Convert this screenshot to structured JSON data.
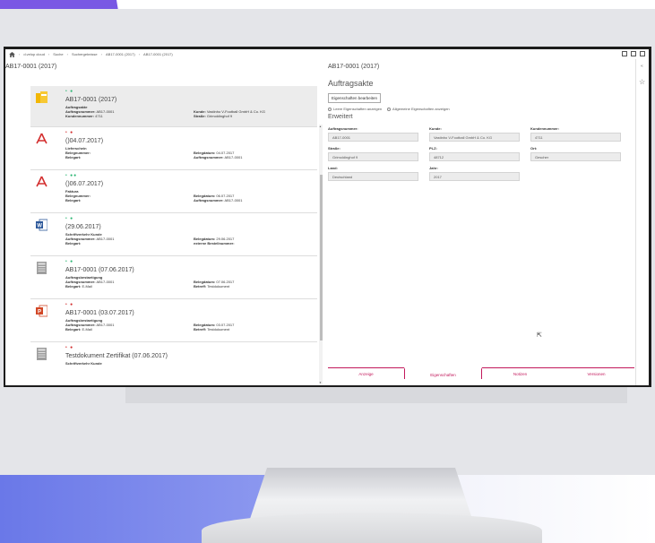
{
  "breadcrumb": {
    "items": [
      "d.velop cloud",
      "Suche",
      "Suchergebnisse",
      "AB17-0001 (2017)",
      "AB17-0001 (2017)"
    ]
  },
  "left_title": "AB17-0001 (2017)",
  "right_title": "AB17-0001 (2017)",
  "documents": [
    {
      "icon": "folder-icon",
      "dots": "• ●",
      "title": "AB17-0001 (2017)",
      "type": "Auftragsakte",
      "l1_label": "Auftragsnummer:",
      "l1_value": "AB17-0001",
      "l2_label": "Kundennummer:",
      "l2_value": "4711",
      "r1_label": "Kunde:",
      "r1_value": "Vastinho V-Football GmbH & Co. KG",
      "r2_label": "Straße:",
      "r2_value": "Grimoldinghof 9"
    },
    {
      "icon": "pdf-icon",
      "dots": "• ●",
      "title": "()04.07.2017)",
      "type": "Lieferschein",
      "l1_label": "Belegnummer:",
      "l1_value": "",
      "l2_label": "Belegart:",
      "l2_value": "",
      "r1_label": "Belegdatum:",
      "r1_value": "04.07.2017",
      "r2_label": "Auftragsnummer:",
      "r2_value": "AB17-0001"
    },
    {
      "icon": "pdf-icon",
      "dots": "• ●●",
      "title": "()06.07.2017)",
      "type": "Faktura",
      "l1_label": "Belegnummer:",
      "l1_value": "",
      "l2_label": "Belegart:",
      "l2_value": "",
      "r1_label": "Belegdatum:",
      "r1_value": "06.07.2017",
      "r2_label": "Auftragsnummer:",
      "r2_value": "AB17-0001"
    },
    {
      "icon": "word-icon",
      "dots": "• ●",
      "title": "(29.06.2017)",
      "type": "Schriftverkehr Kunde",
      "l1_label": "Auftragsnummer:",
      "l1_value": "AB17-0001",
      "l2_label": "Belegart:",
      "l2_value": "",
      "r1_label": "Belegdatum:",
      "r1_value": "29.06.2017",
      "r2_label": "externe Bestellnummer:",
      "r2_value": ""
    },
    {
      "icon": "email-icon",
      "dots": "• ●",
      "title": "AB17-0001 (07.06.2017)",
      "type": "Auftragsbestaetigung",
      "l1_label": "Auftragsnummer:",
      "l1_value": "AB17-0001",
      "l2_label": "Belegart:",
      "l2_value": "E-Mail",
      "r1_label": "Belegdatum:",
      "r1_value": "07.06.2017",
      "r2_label": "Betreff:",
      "r2_value": "Testdokument"
    },
    {
      "icon": "powerpoint-icon",
      "dots": "• ●",
      "title": "AB17-0001 (03.07.2017)",
      "type": "Auftragsbestaetigung",
      "l1_label": "Auftragsnummer:",
      "l1_value": "AB17-0001",
      "l2_label": "Belegart:",
      "l2_value": "E-Mail",
      "r1_label": "Belegdatum:",
      "r1_value": "03.07.2017",
      "r2_label": "Betreff:",
      "r2_value": "Testdokument"
    },
    {
      "icon": "email-icon",
      "dots": "• ●",
      "title": "Testdokument Zertifikat (07.06.2017)",
      "type": "Schriftverkehr Kunde",
      "l1_label": "",
      "l1_value": "",
      "l2_label": "",
      "l2_value": "",
      "r1_label": "",
      "r1_value": "",
      "r2_label": "",
      "r2_value": ""
    }
  ],
  "panel": {
    "heading": "Auftragsakte",
    "edit_button": "Eigenschaften bearbeiten",
    "radio_empty": "Leere Eigenschaften anzeigen",
    "radio_general": "Allgemeine Eigenschaften anzeigen",
    "subheading": "Erweitert",
    "fields": [
      {
        "label": "Auftragsnummer:",
        "value": "AB17-0001"
      },
      {
        "label": "Kunde:",
        "value": "Vastinho V-Football GmbH & Co. KG"
      },
      {
        "label": "Kundennummer:",
        "value": "4711"
      },
      {
        "label": "Straße:",
        "value": "Grimoldinghof 9"
      },
      {
        "label": "PLZ:",
        "value": "48712"
      },
      {
        "label": "Ort:",
        "value": "Gescher"
      },
      {
        "label": "Land:",
        "value": "Deutschland"
      },
      {
        "label": "Jahr:",
        "value": "2017"
      }
    ],
    "tabs": [
      "Anzeige",
      "Eigenschaften",
      "Notizen",
      "Versionen"
    ],
    "active_tab": "Eigenschaften"
  },
  "colors": {
    "accent": "#c2185b",
    "pdf": "#d32f2f",
    "word": "#2b579a",
    "powerpoint": "#d24726",
    "folder": "#f2b705"
  }
}
